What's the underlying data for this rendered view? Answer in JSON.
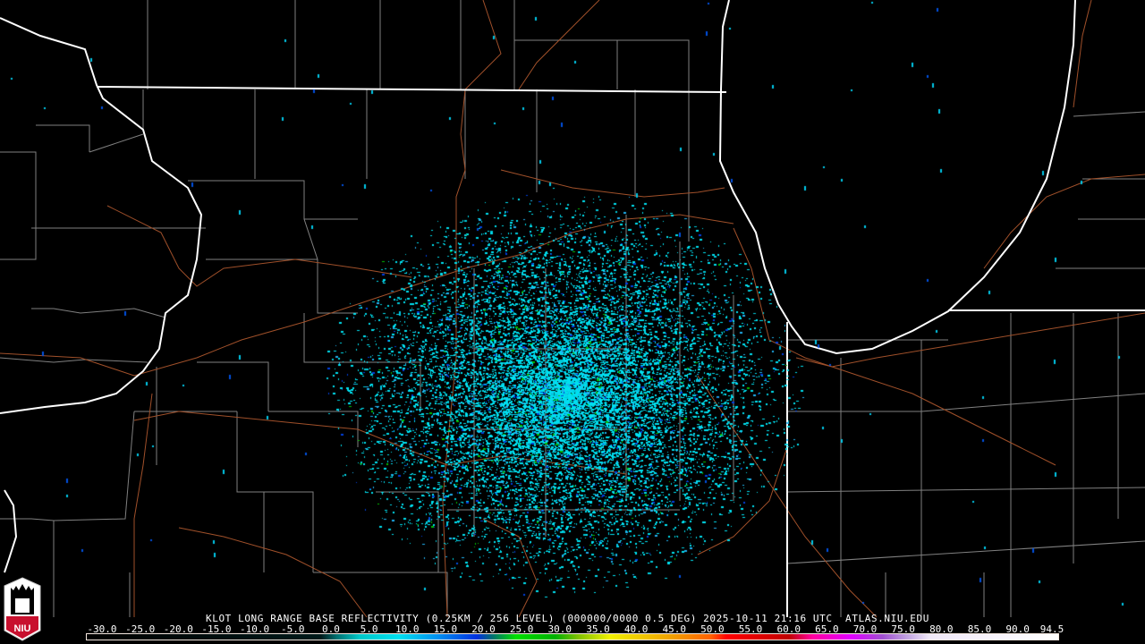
{
  "product_title": "KLOT LONG RANGE BASE REFLECTIVITY (0.25KM / 256 LEVEL) (000000/0000 0.5 DEG) 2025-10-11 21:16 UTC  ATLAS.NIU.EDU",
  "logo_text": "NIU",
  "colorbar": {
    "min": -30.0,
    "max": 94.5,
    "labels": [
      "-30.0",
      "-25.0",
      "-20.0",
      "-15.0",
      "-10.0",
      "-5.0",
      "0.0",
      "5.0",
      "10.0",
      "15.0",
      "20.0",
      "25.0",
      "30.0",
      "35.0",
      "40.0",
      "45.0",
      "50.0",
      "55.0",
      "60.0",
      "65.0",
      "70.0",
      "75.0",
      "80.0",
      "85.0",
      "90.0",
      "94.5"
    ],
    "stops": [
      {
        "v": -30,
        "c": "#000000"
      },
      {
        "v": 0,
        "c": "#001a1a"
      },
      {
        "v": 2,
        "c": "#007070"
      },
      {
        "v": 5,
        "c": "#00c8c8"
      },
      {
        "v": 10,
        "c": "#00e0f0"
      },
      {
        "v": 15,
        "c": "#0090f0"
      },
      {
        "v": 20,
        "c": "#0030e0"
      },
      {
        "v": 22,
        "c": "#007070"
      },
      {
        "v": 25,
        "c": "#00e000"
      },
      {
        "v": 30,
        "c": "#00b000"
      },
      {
        "v": 33,
        "c": "#80c000"
      },
      {
        "v": 37,
        "c": "#f0f000"
      },
      {
        "v": 45,
        "c": "#f0a000"
      },
      {
        "v": 50,
        "c": "#ff6000"
      },
      {
        "v": 52,
        "c": "#ff0000"
      },
      {
        "v": 60,
        "c": "#c00000"
      },
      {
        "v": 63,
        "c": "#ff00a0"
      },
      {
        "v": 68,
        "c": "#e000ff"
      },
      {
        "v": 72,
        "c": "#a050d0"
      },
      {
        "v": 75,
        "c": "#c0a0e0"
      },
      {
        "v": 78,
        "c": "#f0e8f8"
      },
      {
        "v": 94.5,
        "c": "#ffffff"
      }
    ]
  },
  "colors": {
    "state": "#ffffff",
    "county": "#808080",
    "road": "#a0502a",
    "echo": "#00d0e0"
  }
}
